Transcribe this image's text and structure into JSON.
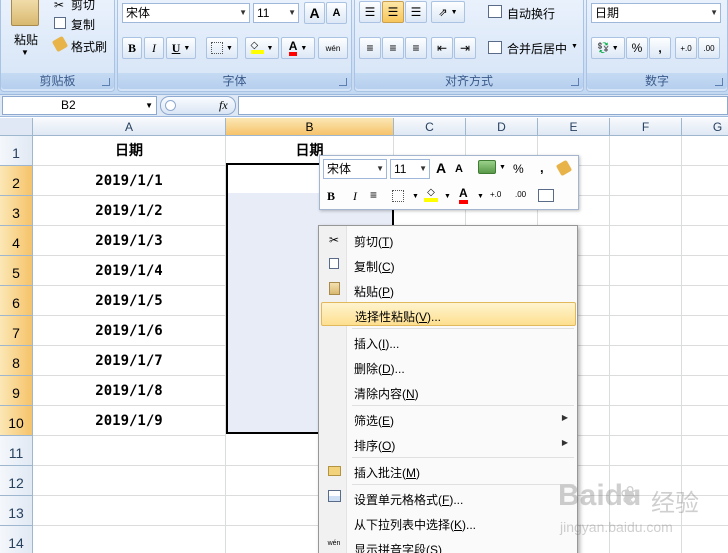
{
  "clipboard": {
    "cut": "剪切",
    "copy": "复制",
    "format_painter": "格式刷",
    "paste": "粘贴",
    "label": "剪贴板"
  },
  "font": {
    "name": "宋体",
    "size": "11",
    "label": "字体",
    "bold": "B",
    "italic": "I",
    "underline": "U",
    "grow": "A",
    "shrink": "A",
    "font_color_glyph": "A",
    "phonetic": "wén"
  },
  "alignment": {
    "wrap": "自动换行",
    "merge": "合并后居中",
    "label": "对齐方式"
  },
  "number": {
    "format": "日期",
    "percent": "%",
    "comma": ",",
    "label": "数字"
  },
  "formula_bar": {
    "name_box": "B2",
    "fx": "fx"
  },
  "columns": [
    "A",
    "B",
    "C",
    "D",
    "E",
    "F",
    "G"
  ],
  "rows": [
    "1",
    "2",
    "3",
    "4",
    "5",
    "6",
    "7",
    "8",
    "9",
    "10",
    "11",
    "12",
    "13",
    "14"
  ],
  "cells": {
    "A1": "日期",
    "B1": "日期",
    "A": [
      "2019/1/1",
      "2019/1/2",
      "2019/1/3",
      "2019/1/4",
      "2019/1/5",
      "2019/1/6",
      "2019/1/7",
      "2019/1/8",
      "2019/1/9"
    ]
  },
  "mini_toolbar": {
    "font": "宋体",
    "size": "11",
    "percent": "%",
    "comma": ","
  },
  "context_menu": {
    "items": [
      {
        "label": "剪切(",
        "key": "T",
        "tail": ")",
        "icon": "scissors-icon"
      },
      {
        "label": "复制(",
        "key": "C",
        "tail": ")",
        "icon": "copy-icon"
      },
      {
        "label": "粘贴(",
        "key": "P",
        "tail": ")",
        "icon": "paste-icon"
      },
      {
        "label": "选择性粘贴(",
        "key": "V",
        "tail": ")...",
        "icon": ""
      },
      {
        "label": "插入(",
        "key": "I",
        "tail": ")...",
        "icon": ""
      },
      {
        "label": "删除(",
        "key": "D",
        "tail": ")...",
        "icon": ""
      },
      {
        "label": "清除内容(",
        "key": "N",
        "tail": ")",
        "icon": ""
      },
      {
        "label": "筛选(",
        "key": "E",
        "tail": ")",
        "icon": ""
      },
      {
        "label": "排序(",
        "key": "O",
        "tail": ")",
        "icon": ""
      },
      {
        "label": "插入批注(",
        "key": "M",
        "tail": ")",
        "icon": "comment-icon"
      },
      {
        "label": "设置单元格格式(",
        "key": "F",
        "tail": ")...",
        "icon": "format-cells-icon"
      },
      {
        "label": "从下拉列表中选择(",
        "key": "K",
        "tail": ")...",
        "icon": ""
      },
      {
        "label": "显示拼音字段(",
        "key": "S",
        "tail": ")",
        "icon": "phonetic-icon"
      }
    ],
    "phonetic_icon_text": "wén",
    "submenu_arrow": "▶"
  },
  "watermark": {
    "brand": "Baidu",
    "cn": "经验",
    "url": "jingyan.baidu.com"
  }
}
